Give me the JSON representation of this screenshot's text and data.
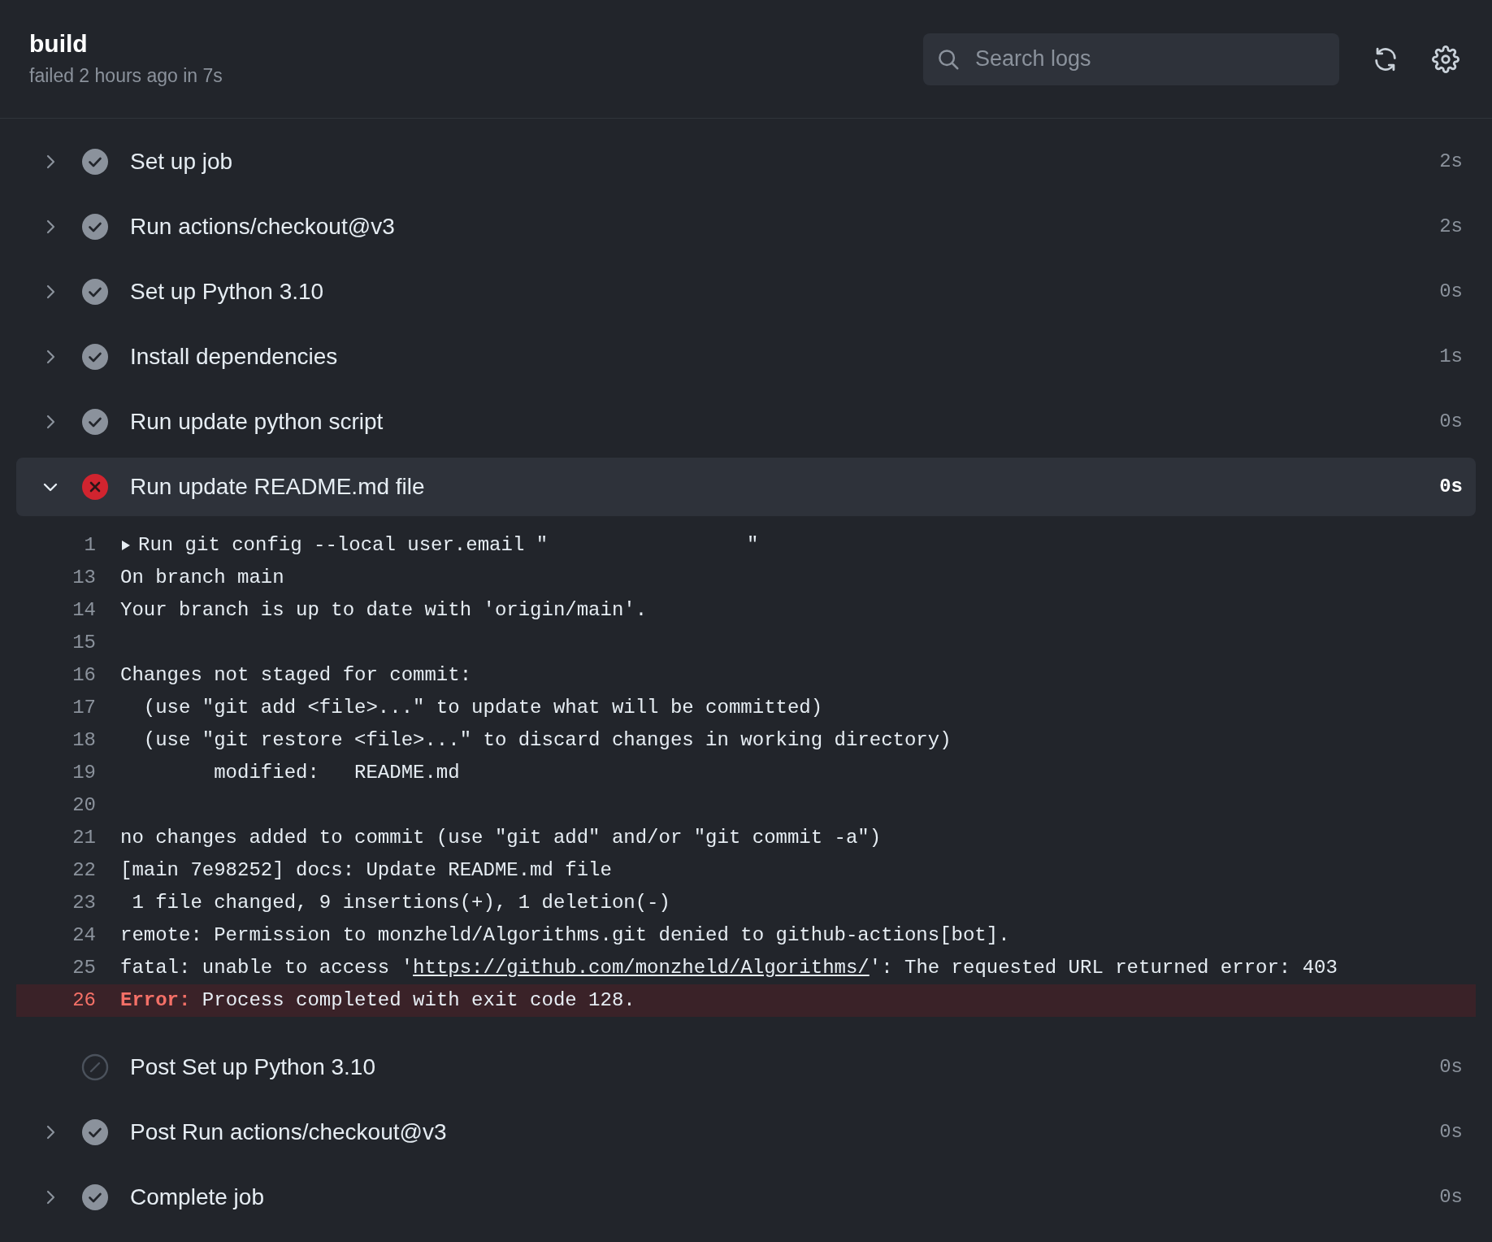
{
  "header": {
    "title": "build",
    "subtitle": "failed 2 hours ago in 7s",
    "search": {
      "placeholder": "Search logs"
    }
  },
  "steps": [
    {
      "name": "Set up job",
      "kind": "success",
      "expanded": false,
      "duration": "2s"
    },
    {
      "name": "Run actions/checkout@v3",
      "kind": "success",
      "expanded": false,
      "duration": "2s"
    },
    {
      "name": "Set up Python 3.10",
      "kind": "success",
      "expanded": false,
      "duration": "0s"
    },
    {
      "name": "Install dependencies",
      "kind": "success",
      "expanded": false,
      "duration": "1s"
    },
    {
      "name": "Run update python script",
      "kind": "success",
      "expanded": false,
      "duration": "0s"
    },
    {
      "name": "Run update README.md file",
      "kind": "failure",
      "expanded": true,
      "duration": "0s",
      "log": [
        {
          "number": "1",
          "kind": "group",
          "text": "Run git config --local user.email \"                 \""
        },
        {
          "number": "13",
          "kind": "plain",
          "text": "On branch main"
        },
        {
          "number": "14",
          "kind": "plain",
          "text": "Your branch is up to date with 'origin/main'."
        },
        {
          "number": "15",
          "kind": "plain"
        },
        {
          "number": "16",
          "kind": "plain",
          "text": "Changes not staged for commit:"
        },
        {
          "number": "17",
          "kind": "plain",
          "text": "  (use \"git add <file>...\" to update what will be committed)"
        },
        {
          "number": "18",
          "kind": "plain",
          "text": "  (use \"git restore <file>...\" to discard changes in working directory)"
        },
        {
          "number": "19",
          "kind": "plain",
          "text": "        modified:   README.md"
        },
        {
          "number": "20",
          "kind": "plain"
        },
        {
          "number": "21",
          "kind": "plain",
          "text": "no changes added to commit (use \"git add\" and/or \"git commit -a\")"
        },
        {
          "number": "22",
          "kind": "plain",
          "text": "[main 7e98252] docs: Update README.md file"
        },
        {
          "number": "23",
          "kind": "plain",
          "text": " 1 file changed, 9 insertions(+), 1 deletion(-)"
        },
        {
          "number": "24",
          "kind": "plain",
          "text": "remote: Permission to monzheld/Algorithms.git denied to github-actions[bot]."
        },
        {
          "number": "25",
          "kind": "link",
          "text": "fatal: unable to access '",
          "link": "https://github.com/monzheld/Algorithms/",
          "suffix": "': The requested URL returned error: 403"
        },
        {
          "number": "26",
          "kind": "error",
          "label": "Error:",
          "text": "Process completed with exit code 128."
        }
      ]
    },
    {
      "name": "Post Set up Python 3.10",
      "kind": "skipped",
      "expanded": false,
      "duration": "0s"
    },
    {
      "name": "Post Run actions/checkout@v3",
      "kind": "success",
      "expanded": false,
      "duration": "0s"
    },
    {
      "name": "Complete job",
      "kind": "success",
      "expanded": false,
      "duration": "0s"
    }
  ]
}
